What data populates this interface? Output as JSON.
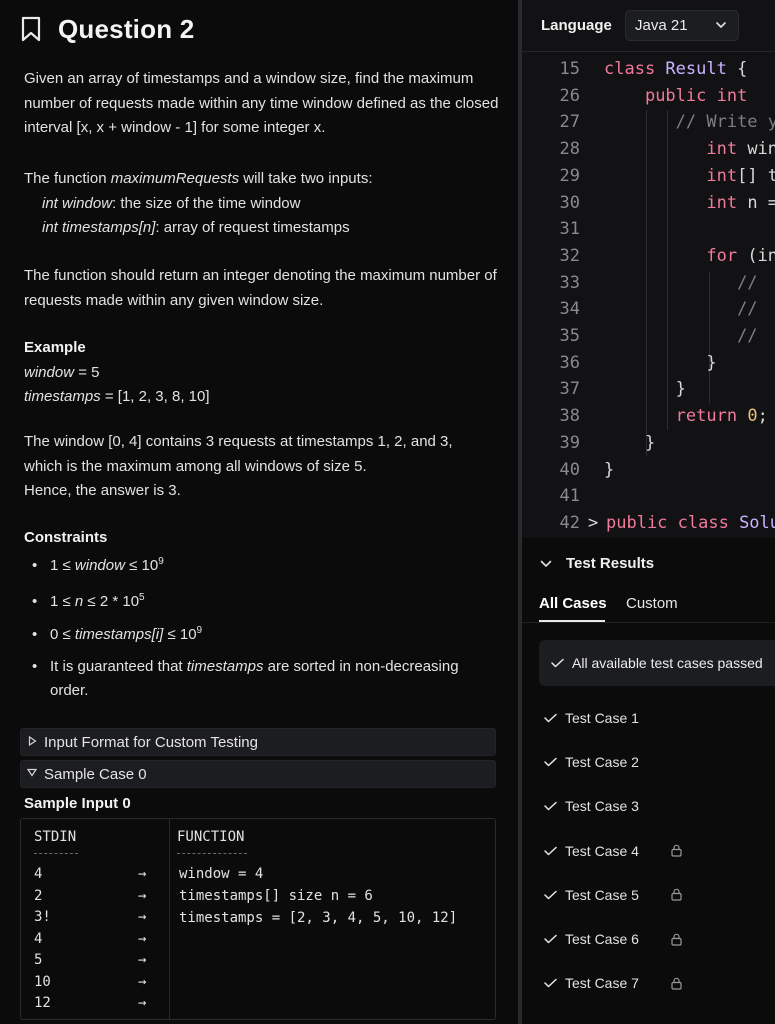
{
  "question": {
    "title": "Question 2",
    "description_1": "Given an array of timestamps and a window size, find the maximum number of requests made within any time window defined as the closed interval [x, x + window - 1] for some integer x.",
    "inputs_intro_pre": "The function ",
    "inputs_intro_fn": "maximumRequests",
    "inputs_intro_post": " will take two inputs:",
    "input_1_name": "int window",
    "input_1_desc": ": the size of the time window",
    "input_2_name": "int timestamps[n]",
    "input_2_desc": ": array of request timestamps",
    "returns": "The function should return an integer denoting the maximum number of requests made within any given window size.",
    "example_heading": "Example",
    "example_window_name": "window",
    "example_window_value": " = 5",
    "example_ts_name": "timestamps",
    "example_ts_value": " = [1, 2, 3, 8, 10]",
    "explanation_1": "The window [0, 4] contains 3 requests at timestamps 1, 2, and 3,",
    "explanation_2": "which is the maximum among all windows of size 5.",
    "explanation_3": "Hence, the answer is 3.",
    "constraints_heading": "Constraints",
    "constraints": {
      "c1_pre": "1 ≤ ",
      "c1_var": "window",
      "c1_mid": " ≤ 10",
      "c1_sup": "9",
      "c2_pre": "1 ≤ ",
      "c2_var": "n",
      "c2_mid": " ≤ 2 * 10",
      "c2_sup": "5",
      "c3_pre": "0 ≤ ",
      "c3_var": "timestamps[i]",
      "c3_mid": " ≤ 10",
      "c3_sup": "9",
      "c4_pre": "It is guaranteed that ",
      "c4_var": "timestamps",
      "c4_post": " are sorted in non-decreasing order."
    },
    "accordion_input_format": "Input Format for Custom Testing",
    "accordion_sample_case": "Sample Case 0",
    "sample_input_heading": "Sample Input 0",
    "sample": {
      "stdin_header": "STDIN",
      "function_header": "FUNCTION",
      "stdin": [
        "4",
        "2",
        "3!",
        "4",
        "5",
        "10",
        "12"
      ],
      "arrow": "→",
      "function": [
        "window = 4",
        "timestamps[] size n = 6",
        "timestamps = [2, 3, 4, 5, 10, 12]"
      ]
    }
  },
  "editor": {
    "language_label": "Language",
    "language_value": "Java 21",
    "lines": [
      {
        "n": "15",
        "parts": [
          [
            "kw",
            "class "
          ],
          [
            "ty",
            "Result"
          ],
          [
            "",
            "&nbsp;{"
          ]
        ]
      },
      {
        "n": "26",
        "parts": [
          [
            "",
            "    "
          ],
          [
            "kw",
            "public "
          ],
          [
            "kw",
            "int"
          ]
        ]
      },
      {
        "n": "27",
        "parts": [
          [
            "",
            "       "
          ],
          [
            "cm",
            "// Write yo"
          ]
        ]
      },
      {
        "n": "28",
        "parts": [
          [
            "",
            "          "
          ],
          [
            "kw",
            "int "
          ],
          [
            "",
            "wind"
          ]
        ]
      },
      {
        "n": "29",
        "parts": [
          [
            "",
            "          "
          ],
          [
            "kw",
            "int"
          ],
          [
            "",
            "[] ti"
          ]
        ]
      },
      {
        "n": "30",
        "parts": [
          [
            "",
            "          "
          ],
          [
            "kw",
            "int "
          ],
          [
            "",
            "n ="
          ]
        ]
      },
      {
        "n": "31",
        "parts": []
      },
      {
        "n": "32",
        "parts": [
          [
            "",
            "          "
          ],
          [
            "kw",
            "for "
          ],
          [
            "",
            "(int"
          ]
        ]
      },
      {
        "n": "33",
        "parts": [
          [
            "",
            "             "
          ],
          [
            "cm",
            "//"
          ]
        ]
      },
      {
        "n": "34",
        "parts": [
          [
            "",
            "             "
          ],
          [
            "cm",
            "//"
          ]
        ]
      },
      {
        "n": "35",
        "parts": [
          [
            "",
            "             "
          ],
          [
            "cm",
            "//"
          ]
        ]
      },
      {
        "n": "36",
        "parts": [
          [
            "",
            "          "
          ],
          [
            "",
            "}"
          ]
        ]
      },
      {
        "n": "37",
        "parts": [
          [
            "",
            "       "
          ],
          [
            "",
            "}"
          ]
        ]
      },
      {
        "n": "38",
        "parts": [
          [
            "",
            "       "
          ],
          [
            "kw",
            "return "
          ],
          [
            "num",
            "0"
          ],
          [
            "",
            ";"
          ]
        ]
      },
      {
        "n": "39",
        "parts": [
          [
            "",
            "    "
          ],
          [
            "",
            "}"
          ]
        ]
      },
      {
        "n": "40",
        "parts": [
          [
            "",
            "}"
          ]
        ]
      },
      {
        "n": "41",
        "parts": []
      },
      {
        "n": "42",
        "parts": [
          [
            "kw",
            "public class "
          ],
          [
            "ty",
            "Solut"
          ]
        ]
      }
    ],
    "line_42_marker": ">"
  },
  "tests": {
    "heading": "Test Results",
    "tab_all": "All Cases",
    "tab_custom": "Custom",
    "banner": "All available test cases passed",
    "cases": [
      {
        "label": "Test Case 1",
        "locked": false
      },
      {
        "label": "Test Case 2",
        "locked": false
      },
      {
        "label": "Test Case 3",
        "locked": false
      },
      {
        "label": "Test Case 4",
        "locked": true
      },
      {
        "label": "Test Case 5",
        "locked": true
      },
      {
        "label": "Test Case 6",
        "locked": true
      },
      {
        "label": "Test Case 7",
        "locked": true
      }
    ]
  },
  "colors": {
    "background": "#0b0b0c",
    "editor_bg": "#121214",
    "keyword": "#f07a9a",
    "type": "#c9b3ff",
    "comment": "#7d7d85"
  },
  "icons": [
    "bookmark-icon",
    "chevron-down-icon",
    "chevron-right-icon",
    "check-icon",
    "lock-icon",
    "triangle-right-icon",
    "triangle-down-icon"
  ]
}
